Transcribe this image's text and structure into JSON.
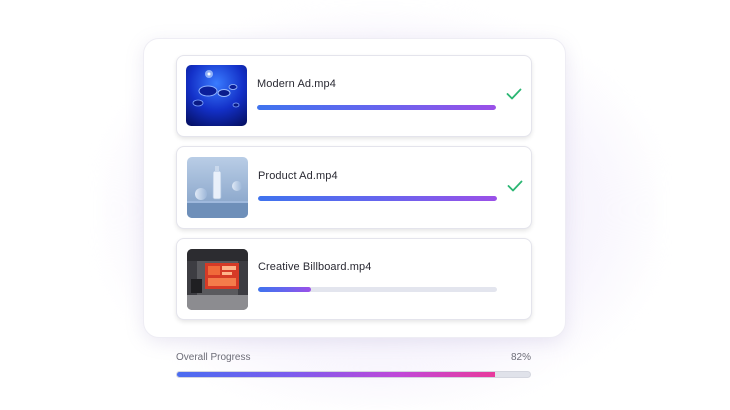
{
  "uploads": [
    {
      "name": "Modern Ad.mp4",
      "thumbnail": "blue-water-drops",
      "progress": 100,
      "status": "complete",
      "status_icon": "check-icon"
    },
    {
      "name": "Product Ad.mp4",
      "thumbnail": "bottle-product-render",
      "progress": 100,
      "status": "complete",
      "status_icon": "check-icon"
    },
    {
      "name": "Creative Billboard.mp4",
      "thumbnail": "street-billboard",
      "progress": 22,
      "status": "uploading"
    }
  ],
  "overall": {
    "label": "Overall Progress",
    "percent_label": "82%",
    "progress": 90
  },
  "colors": {
    "bar_start": "#3f73ee",
    "bar_end": "#9b50e8",
    "overall_end": "#e83a9c",
    "check": "#2bb673",
    "track": "#e3e5ee"
  }
}
